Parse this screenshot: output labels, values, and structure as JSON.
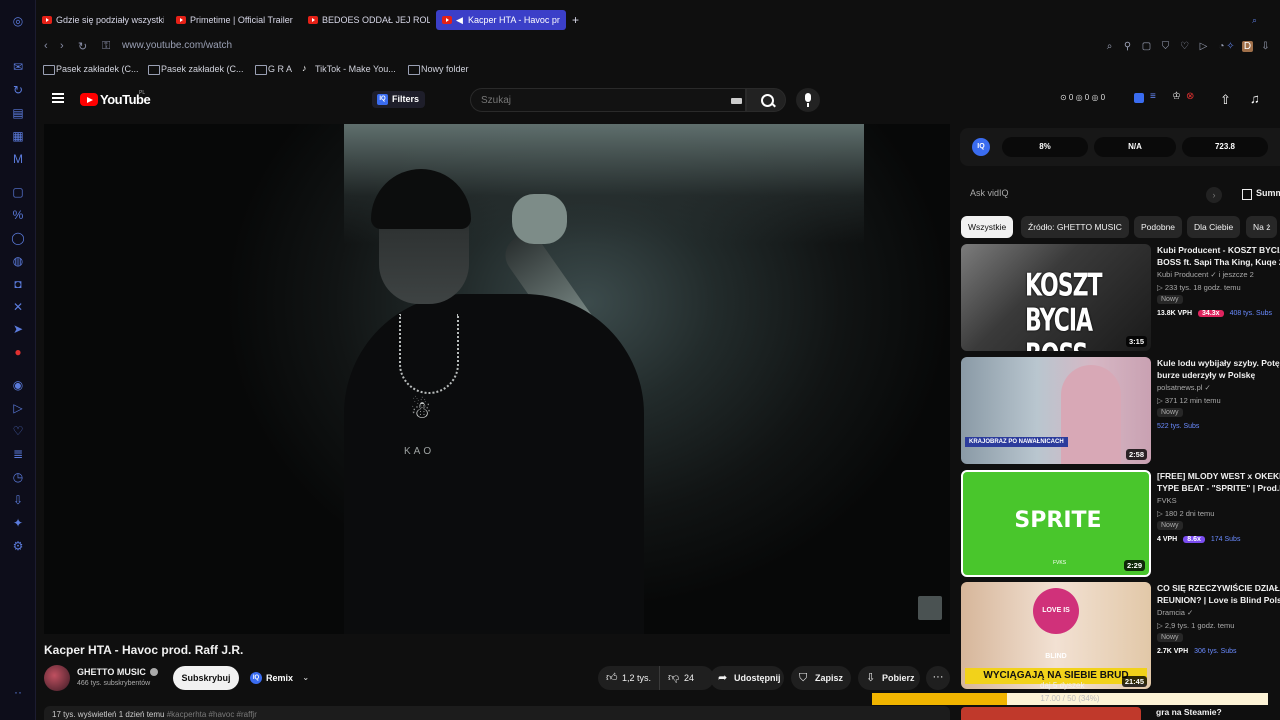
{
  "browser": {
    "tabs": [
      {
        "label": "Gdzie się podziały wszystki"
      },
      {
        "label": "Primetime | Official Trailer"
      },
      {
        "label": "BEDOES ODDAŁ JEJ ROLĘ"
      },
      {
        "label": "Kacper HTA - Havoc pr"
      }
    ],
    "new_tab": "+",
    "url": "www.youtube.com/watch",
    "bookmarks": [
      "Pasek zakładek (C...",
      "Pasek zakładek (C...",
      "G R A",
      "TikTok - Make You...",
      "Nowy folder"
    ]
  },
  "youtube": {
    "logo_text": "YouTube",
    "country": "PL",
    "filters_label": "Filters",
    "search_placeholder": "Szukaj",
    "header_stats": "⊙ 0  ◎ 0  ◎ 0"
  },
  "video": {
    "title": "Kacper HTA - Havoc prod. Raff J.R.",
    "shirt_text": "KAO",
    "channel": {
      "name": "GHETTO MUSIC",
      "subscribers": "466 tys. subskrybentów"
    },
    "subscribe_label": "Subskrybuj",
    "remix_label": "Remix",
    "likes": "1,2 tys.",
    "dislikes": "24",
    "share_label": "Udostępnij",
    "save_label": "Zapisz",
    "download_label": "Pobierz",
    "description_views": "17 tys. wyświetleń  1 dzień temu",
    "description_tags": "#kacperhta #havoc #raffjr"
  },
  "vidiq": {
    "logo": "IQ",
    "metrics": [
      "8%",
      "N/A",
      "723.8"
    ],
    "ask_placeholder": "Ask vidIQ",
    "summary_label": "Summ"
  },
  "chips": [
    "Wszystkie",
    "Źródło: GHETTO MUSIC",
    "Podobne",
    "Dla Ciebie",
    "Na ż"
  ],
  "recommendations": [
    {
      "title": "Kubi Producent - KOSZT BYCIA",
      "title2": "BOSS ft. Sapi Tha King, Kuqe 21",
      "channel": "Kubi Producent ✓ i jeszcze 2",
      "meta": "▷ 233 tys.  18 godz. temu",
      "badge": "Nowy",
      "vph": "13.8K VPH",
      "ratio": "34.3x",
      "ratio_color": "#e0245e",
      "subs": "408 tys. Subs",
      "duration": "3:15",
      "thumb_text": "KOSZT BYCIA BOSS"
    },
    {
      "title": "Kule lodu wybijały szyby. Potężne",
      "title2": "burze uderzyły w Polskę",
      "channel": "polsatnews.pl ✓",
      "meta": "▷ 371  12 min temu",
      "badge": "Nowy",
      "vph": "",
      "ratio": "",
      "ratio_color": "#6a8bff",
      "subs": "522 tys. Subs",
      "duration": "2:58",
      "thumb_text": "KRAJOBRAZ PO NAWAŁNICACH"
    },
    {
      "title": "[FREE] MLODY WEST x OKEKEL",
      "title2": "TYPE BEAT - \"SPRITE\" | Prod.Fvks",
      "channel": "FVKS",
      "meta": "▷ 180  2 dni temu",
      "badge": "Nowy",
      "vph": "4 VPH",
      "ratio": "8.6x",
      "ratio_color": "#7a4cf0",
      "subs": "174 Subs",
      "duration": "2:29",
      "thumb_text": "SPRITE",
      "thumb_label": "FVKS"
    },
    {
      "title": "CO SIĘ RZECZYWIŚCIE DZIAŁO",
      "title2": "REUNION? | Love is Blind Polska",
      "channel": "Dramcia ✓",
      "meta": "▷ 2,9 tys.  1 godz. temu",
      "badge": "Nowy",
      "vph": "2.7K VPH",
      "ratio": "",
      "ratio_color": "#6a8bff",
      "subs": "306 tys. Subs",
      "duration": "21:45",
      "thumb_text": "WYCIĄGAJĄ NA SIEBIE BRUD",
      "thumb_logo": "LOVE IS BLIND"
    }
  ],
  "overlay": {
    "text": "daj 5 dyszek",
    "progress_label": "17.00 / 50 (34%)",
    "progress": 0.34,
    "next_title": "gra na Steamie?"
  }
}
